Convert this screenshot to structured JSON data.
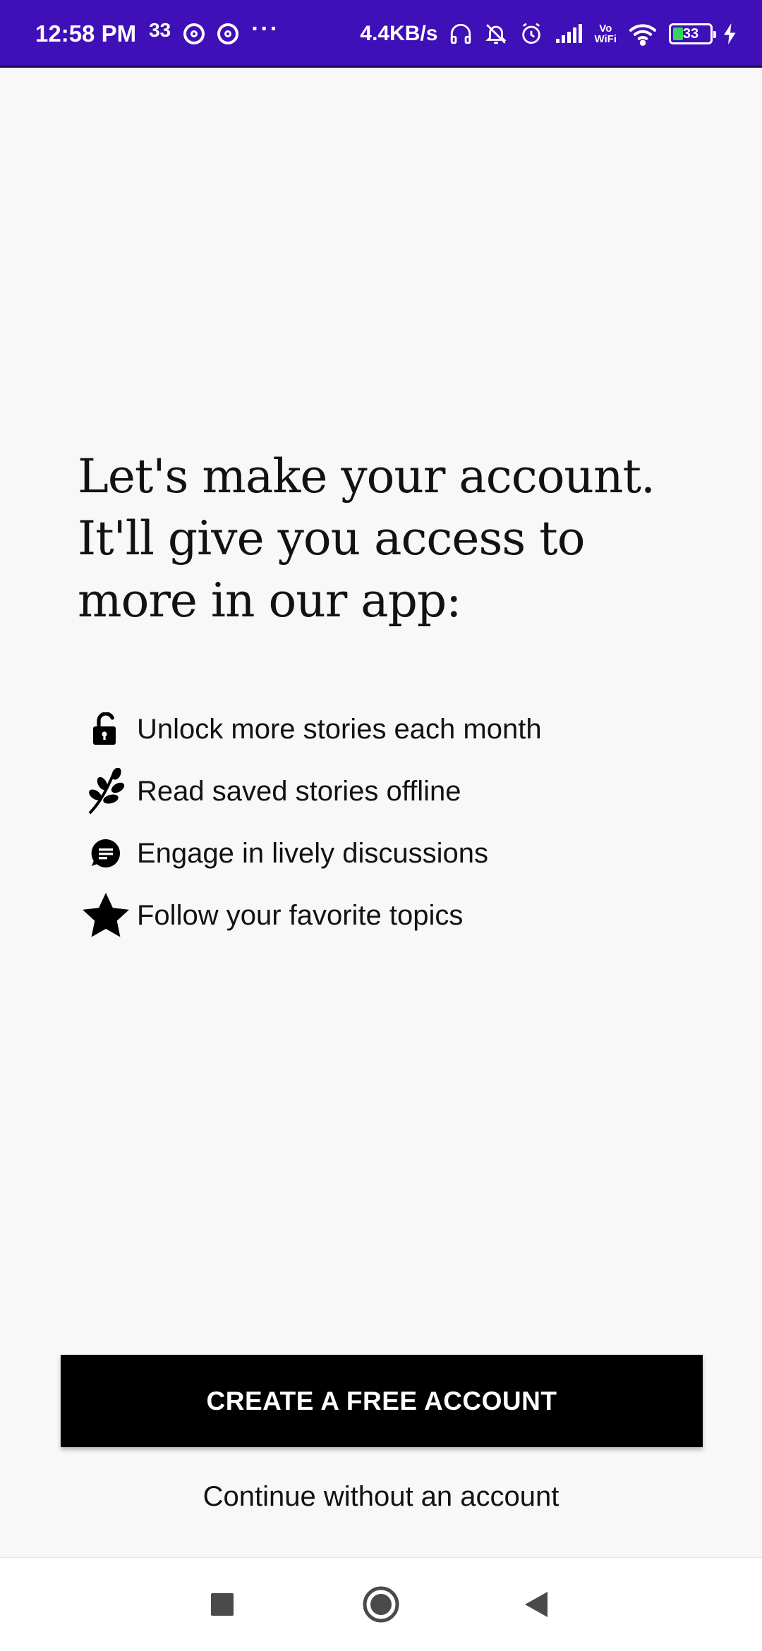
{
  "status_bar": {
    "time": "12:58 PM",
    "notification_count": "33",
    "overflow": "···",
    "net_speed": "4.4KB/s",
    "volte_top": "Vo",
    "volte_bottom": "WiFi",
    "battery_level": "33",
    "background_color": "#3f0fb8"
  },
  "onboarding": {
    "headline": "Let's make your account. It'll give you access to more in our app:",
    "benefits": [
      {
        "icon": "unlock-icon",
        "text": "Unlock more stories each month"
      },
      {
        "icon": "sprig-icon",
        "text": "Read saved stories offline"
      },
      {
        "icon": "comment-bubble-icon",
        "text": "Engage in lively discussions"
      },
      {
        "icon": "star-icon",
        "text": "Follow your favorite topics"
      }
    ],
    "create_account_label": "CREATE A FREE ACCOUNT",
    "continue_label": "Continue without an account"
  },
  "nav_bar": {
    "buttons": [
      "recents-square-icon",
      "home-circle-icon",
      "back-triangle-icon"
    ]
  }
}
